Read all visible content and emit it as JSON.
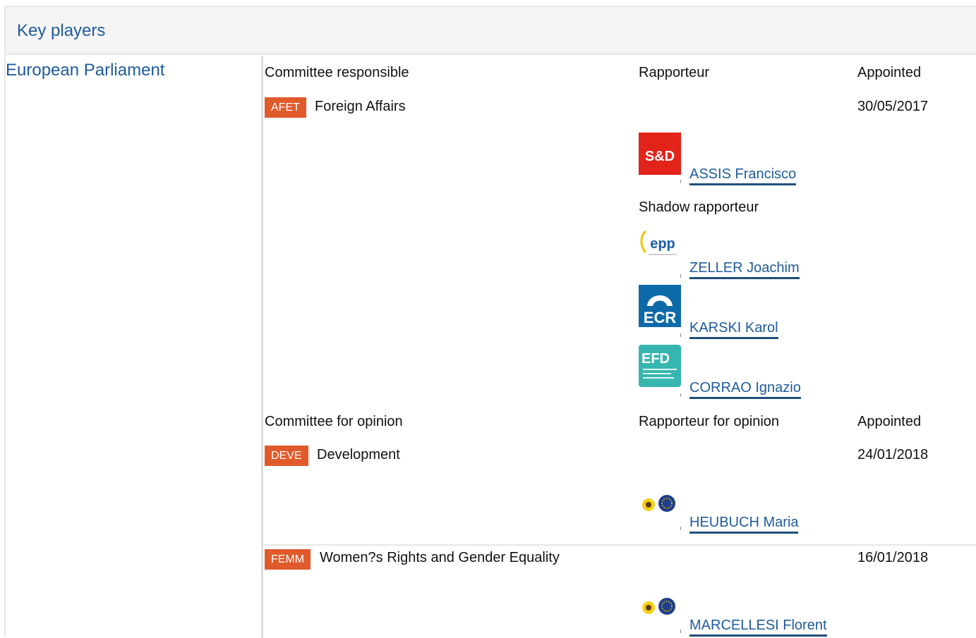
{
  "panel": {
    "title": "Key players",
    "institution": "European Parliament"
  },
  "responsible": {
    "headers": {
      "committee": "Committee responsible",
      "rapporteur": "Rapporteur",
      "appointed": "Appointed"
    },
    "committee": {
      "code": "AFET",
      "name": "Foreign Affairs",
      "date": "30/05/2017"
    },
    "rapporteur": {
      "group": "S&D",
      "name": "ASSIS Francisco"
    },
    "shadow_label": "Shadow rapporteur",
    "shadows": [
      {
        "group": "epp",
        "name": "ZELLER Joachim"
      },
      {
        "group": "ECR",
        "name": "KARSKI Karol"
      },
      {
        "group": "EFD",
        "name": "CORRAO Ignazio"
      }
    ]
  },
  "opinion": {
    "headers": {
      "committee": "Committee for opinion",
      "rapporteur": "Rapporteur for opinion",
      "appointed": "Appointed"
    },
    "committees": [
      {
        "code": "DEVE",
        "name": "Development",
        "date": "24/01/2018",
        "rapporteur": {
          "group": "Verts/ALE",
          "name": "HEUBUCH Maria"
        }
      },
      {
        "code": "FEMM",
        "name": "Women?s Rights and Gender Equality",
        "date": "16/01/2018",
        "rapporteur": {
          "group": "Verts/ALE",
          "name": "MARCELLESI Florent"
        }
      }
    ]
  },
  "colors": {
    "link": "#1f5b9c",
    "badge": "#e05a2b",
    "sd_red": "#e2231a",
    "ecr_blue": "#0d6aa8",
    "efd_teal": "#37b6b0"
  }
}
